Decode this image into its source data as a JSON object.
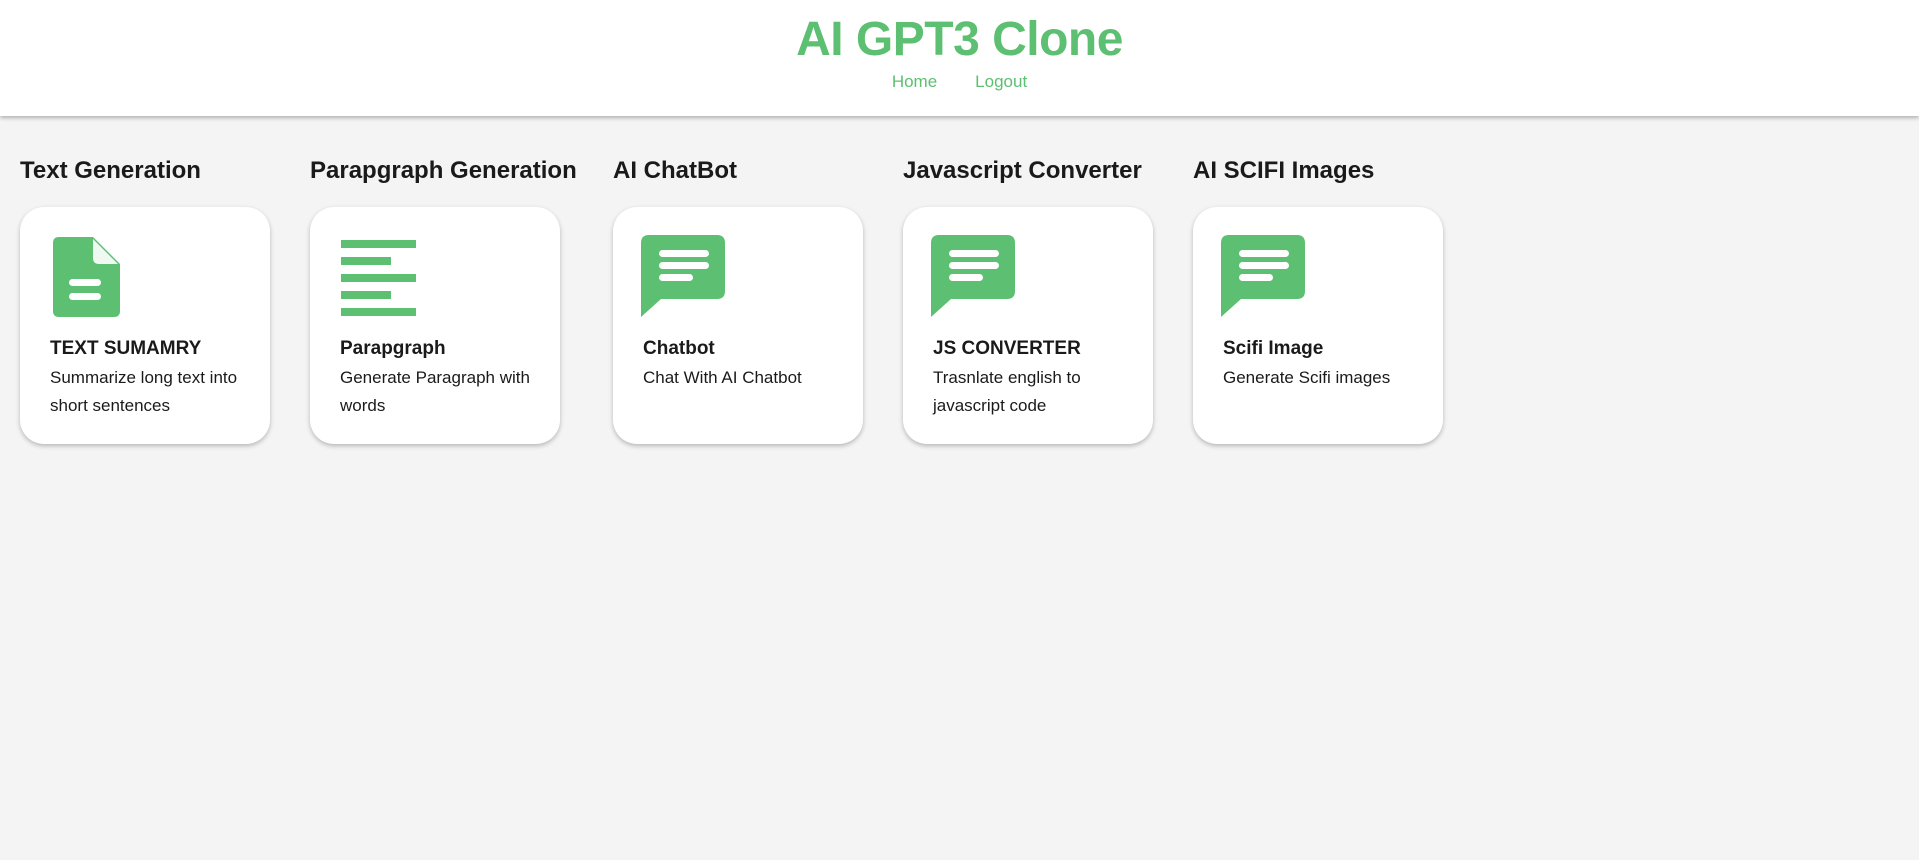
{
  "theme": {
    "accent": "#5cbf71",
    "background": "#f4f4f4",
    "card": "#ffffff"
  },
  "header": {
    "title": "AI GPT3 Clone",
    "nav": {
      "home": "Home",
      "logout": "Logout"
    }
  },
  "sections": [
    {
      "title": "Text Generation",
      "card": {
        "icon": "document-icon",
        "title": "TEXT SUMAMRY",
        "description": "Summarize long text into short sentences"
      }
    },
    {
      "title": "Parapgraph Generation",
      "card": {
        "icon": "paragraph-lines-icon",
        "title": "Parapgraph",
        "description": "Generate Paragraph with words"
      }
    },
    {
      "title": "AI ChatBot",
      "card": {
        "icon": "chat-bubble-icon",
        "title": "Chatbot",
        "description": "Chat With AI Chatbot"
      }
    },
    {
      "title": "Javascript Converter",
      "card": {
        "icon": "chat-bubble-icon",
        "title": "JS CONVERTER",
        "description": "Trasnlate english to javascript code"
      }
    },
    {
      "title": "AI SCIFI Images",
      "card": {
        "icon": "chat-bubble-icon",
        "title": "Scifi Image",
        "description": "Generate Scifi images"
      }
    }
  ]
}
